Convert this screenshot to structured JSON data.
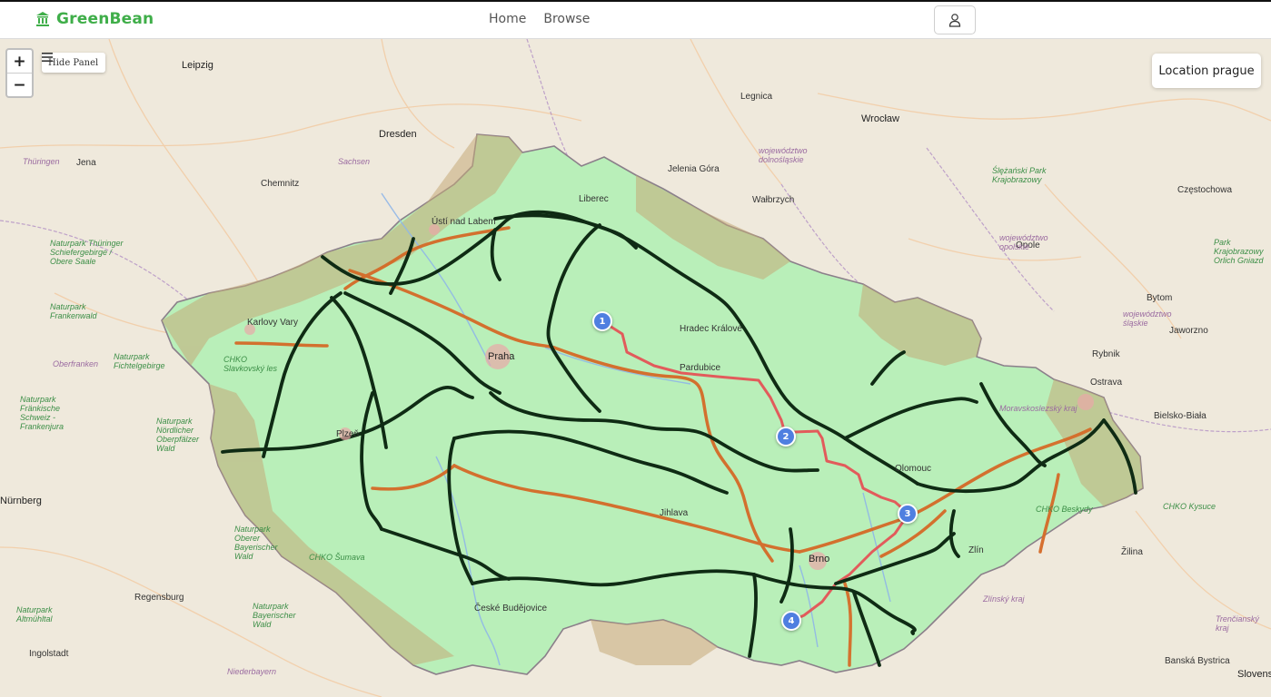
{
  "brand": {
    "name": "GreenBean",
    "icon": "building-icon",
    "color": "#3fae49"
  },
  "nav": {
    "links": [
      "Home",
      "Browse"
    ],
    "user_icon": "user-icon"
  },
  "map_controls": {
    "zoom_in": "+",
    "zoom_out": "−",
    "panel_toggle": "Hide Panel",
    "panel_icon": "menu-icon",
    "location_label": "Location prague"
  },
  "markers": [
    "1",
    "2",
    "3",
    "4"
  ],
  "map_labels": {
    "cities": [
      "Leipzig",
      "Dresden",
      "Wrocław",
      "Chemnitz",
      "Jena",
      "Legnica",
      "Wałbrzych",
      "Jelenia Góra",
      "Liberec",
      "Ústí nad Labem",
      "Karlovy Vary",
      "Praha",
      "Hradec Králové",
      "Pardubice",
      "Plzeň",
      "Jihlava",
      "Brno",
      "Olomouc",
      "Zlín",
      "České Budějovice",
      "Regensburg",
      "Ingolstadt",
      "Nürnberg",
      "Częstochowa",
      "Opole",
      "Bytom",
      "Jaworzno",
      "Rybnik",
      "Ostrava",
      "Bielsko-Biała",
      "Žilina",
      "Banská Bystrica",
      "Slovensko"
    ],
    "regions": [
      "Sachsen",
      "Thüringen",
      "województwo dolnośląskie",
      "województwo opolskie",
      "województwo śląskie",
      "Oberfranken",
      "Niederbayern",
      "Moravskoslezský kraj",
      "Zlínský kraj",
      "Trenčianský kraj"
    ],
    "parks": [
      "Naturpark Thüringer Schiefergebirge / Obere Saale",
      "Naturpark Frankenwald",
      "Naturpark Fichtelgebirge",
      "Naturpark Fränkische Schweiz - Frankenjura",
      "Naturpark Nördlicher Oberpfälzer Wald",
      "Naturpark Oberer Bayerischer Wald",
      "Naturpark Bayerischer Wald",
      "Naturpark Altmühltal",
      "CHKO Slavkovský les",
      "CHKO Šumava",
      "Ślężański Park Krajobrazowy",
      "Park Krajobrazowy Orlich Gniazd",
      "CHKO Beskydy",
      "CHKO Kysuce"
    ]
  },
  "colors": {
    "land_cz": "#b9efb9",
    "land_outside": "#f1ece1",
    "track_dark": "#0f2b14",
    "track_orange": "#d56a27",
    "route_red": "#e25b5b",
    "marker": "#4f7fe0"
  }
}
